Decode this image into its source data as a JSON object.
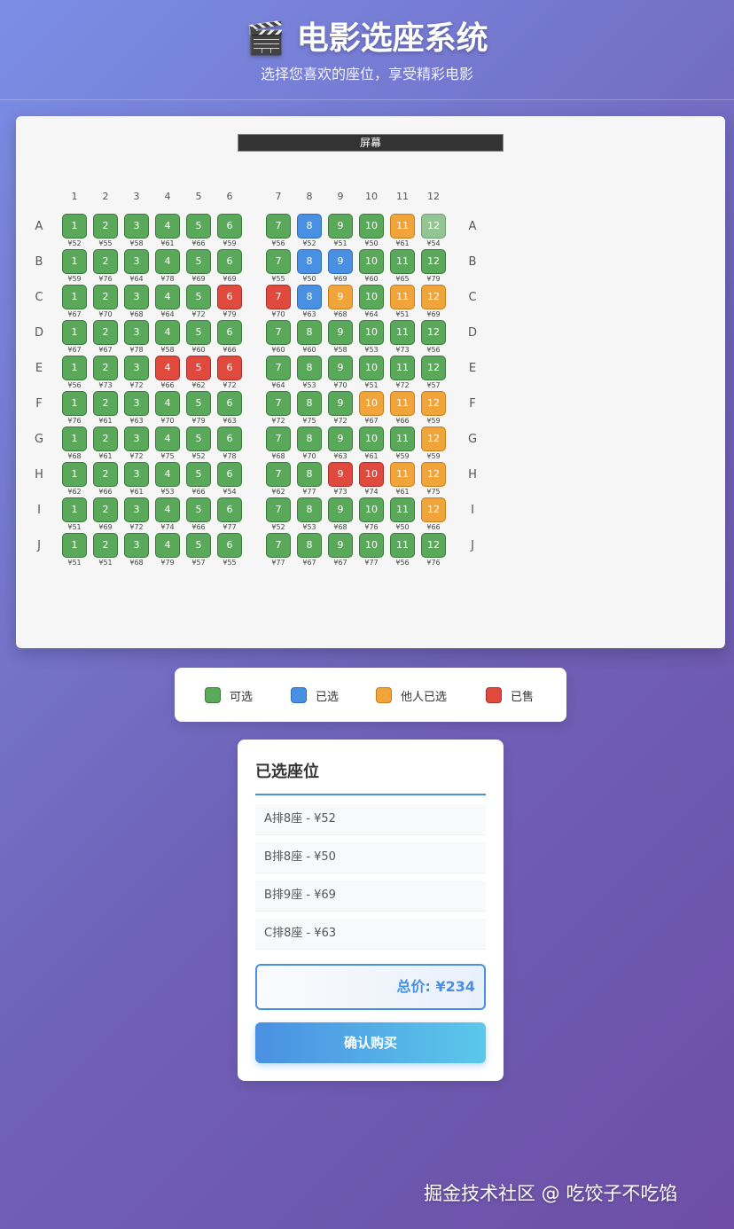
{
  "header": {
    "icon": "clapperboard-icon",
    "title": "🎬 电影选座系统",
    "subtitle": "选择您喜欢的座位，享受精彩电影"
  },
  "screen_label": "屏幕",
  "columns": [
    "1",
    "2",
    "3",
    "4",
    "5",
    "6",
    "7",
    "8",
    "9",
    "10",
    "11",
    "12"
  ],
  "rows": [
    "A",
    "B",
    "C",
    "D",
    "E",
    "F",
    "G",
    "H",
    "I",
    "J"
  ],
  "seat_status_by_row": [
    [
      "available",
      "available",
      "available",
      "available",
      "available",
      "available",
      "available",
      "selected",
      "available",
      "available",
      "others",
      "hover"
    ],
    [
      "available",
      "available",
      "available",
      "available",
      "available",
      "available",
      "available",
      "selected",
      "selected",
      "available",
      "available",
      "available"
    ],
    [
      "available",
      "available",
      "available",
      "available",
      "available",
      "sold",
      "sold",
      "selected",
      "others",
      "available",
      "others",
      "others"
    ],
    [
      "available",
      "available",
      "available",
      "available",
      "available",
      "available",
      "available",
      "available",
      "available",
      "available",
      "available",
      "available"
    ],
    [
      "available",
      "available",
      "available",
      "sold",
      "sold",
      "sold",
      "available",
      "available",
      "available",
      "available",
      "available",
      "available"
    ],
    [
      "available",
      "available",
      "available",
      "available",
      "available",
      "available",
      "available",
      "available",
      "available",
      "others",
      "others",
      "others"
    ],
    [
      "available",
      "available",
      "available",
      "available",
      "available",
      "available",
      "available",
      "available",
      "available",
      "available",
      "available",
      "others"
    ],
    [
      "available",
      "available",
      "available",
      "available",
      "available",
      "available",
      "available",
      "available",
      "sold",
      "sold",
      "others",
      "others"
    ],
    [
      "available",
      "available",
      "available",
      "available",
      "available",
      "available",
      "available",
      "available",
      "available",
      "available",
      "available",
      "others"
    ],
    [
      "available",
      "available",
      "available",
      "available",
      "available",
      "available",
      "available",
      "available",
      "available",
      "available",
      "available",
      "available"
    ]
  ],
  "seat_prices_by_row": [
    [
      "¥52",
      "¥55",
      "¥58",
      "¥61",
      "¥66",
      "¥59",
      "¥56",
      "¥52",
      "¥51",
      "¥50",
      "¥61",
      "¥54"
    ],
    [
      "¥59",
      "¥76",
      "¥64",
      "¥78",
      "¥69",
      "¥69",
      "¥55",
      "¥50",
      "¥69",
      "¥60",
      "¥65",
      "¥79"
    ],
    [
      "¥67",
      "¥70",
      "¥68",
      "¥64",
      "¥72",
      "¥79",
      "¥70",
      "¥63",
      "¥68",
      "¥64",
      "¥51",
      "¥69"
    ],
    [
      "¥67",
      "¥67",
      "¥78",
      "¥58",
      "¥60",
      "¥66",
      "¥60",
      "¥60",
      "¥58",
      "¥53",
      "¥73",
      "¥56"
    ],
    [
      "¥56",
      "¥73",
      "¥72",
      "¥66",
      "¥62",
      "¥72",
      "¥64",
      "¥53",
      "¥70",
      "¥51",
      "¥72",
      "¥57"
    ],
    [
      "¥76",
      "¥61",
      "¥63",
      "¥70",
      "¥79",
      "¥63",
      "¥72",
      "¥75",
      "¥72",
      "¥67",
      "¥66",
      "¥59"
    ],
    [
      "¥68",
      "¥61",
      "¥72",
      "¥75",
      "¥52",
      "¥78",
      "¥68",
      "¥70",
      "¥63",
      "¥61",
      "¥59",
      "¥59"
    ],
    [
      "¥62",
      "¥66",
      "¥61",
      "¥53",
      "¥66",
      "¥54",
      "¥62",
      "¥77",
      "¥73",
      "¥74",
      "¥61",
      "¥75"
    ],
    [
      "¥51",
      "¥69",
      "¥72",
      "¥74",
      "¥66",
      "¥77",
      "¥52",
      "¥53",
      "¥68",
      "¥76",
      "¥50",
      "¥66"
    ],
    [
      "¥51",
      "¥51",
      "¥68",
      "¥79",
      "¥57",
      "¥55",
      "¥77",
      "¥67",
      "¥67",
      "¥77",
      "¥56",
      "¥76"
    ]
  ],
  "legend": [
    {
      "label": "可选",
      "status": "available"
    },
    {
      "label": "已选",
      "status": "selected"
    },
    {
      "label": "他人已选",
      "status": "others"
    },
    {
      "label": "已售",
      "status": "sold"
    }
  ],
  "colors": {
    "available": "#5aa85a",
    "selected": "#4a90e2",
    "others": "#f0a43a",
    "sold": "#e04a3e",
    "hover": "#93c493",
    "accent": "#4a90e2"
  },
  "panel": {
    "title": "已选座位",
    "selected_items": [
      "A排8座 - ¥52",
      "B排8座 - ¥50",
      "B排9座 - ¥69",
      "C排8座 - ¥63"
    ],
    "total": "总价: ¥234",
    "buy_label": "确认购买"
  },
  "watermark": "掘金技术社区 @ 吃饺子不吃馅"
}
